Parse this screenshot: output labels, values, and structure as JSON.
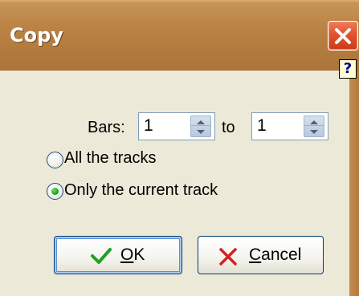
{
  "window": {
    "title": "Copy",
    "help_glyph": "?"
  },
  "bars": {
    "label": "Bars:",
    "from_value": "1",
    "to_label": "to",
    "to_value": "1"
  },
  "options": [
    {
      "label": "All the tracks",
      "checked": false
    },
    {
      "label": "Only the current track",
      "checked": true
    }
  ],
  "buttons": {
    "ok": {
      "mnemonic": "O",
      "rest": "K",
      "icon": "checkmark-icon"
    },
    "cancel": {
      "mnemonic": "C",
      "rest": "ancel",
      "icon": "x-icon"
    }
  },
  "colors": {
    "titlebar": "#b27a3d",
    "face": "#ece9d8",
    "close": "#e2532f",
    "check": "#22a022",
    "cross": "#d62020",
    "radio_dot": "#21a121"
  }
}
